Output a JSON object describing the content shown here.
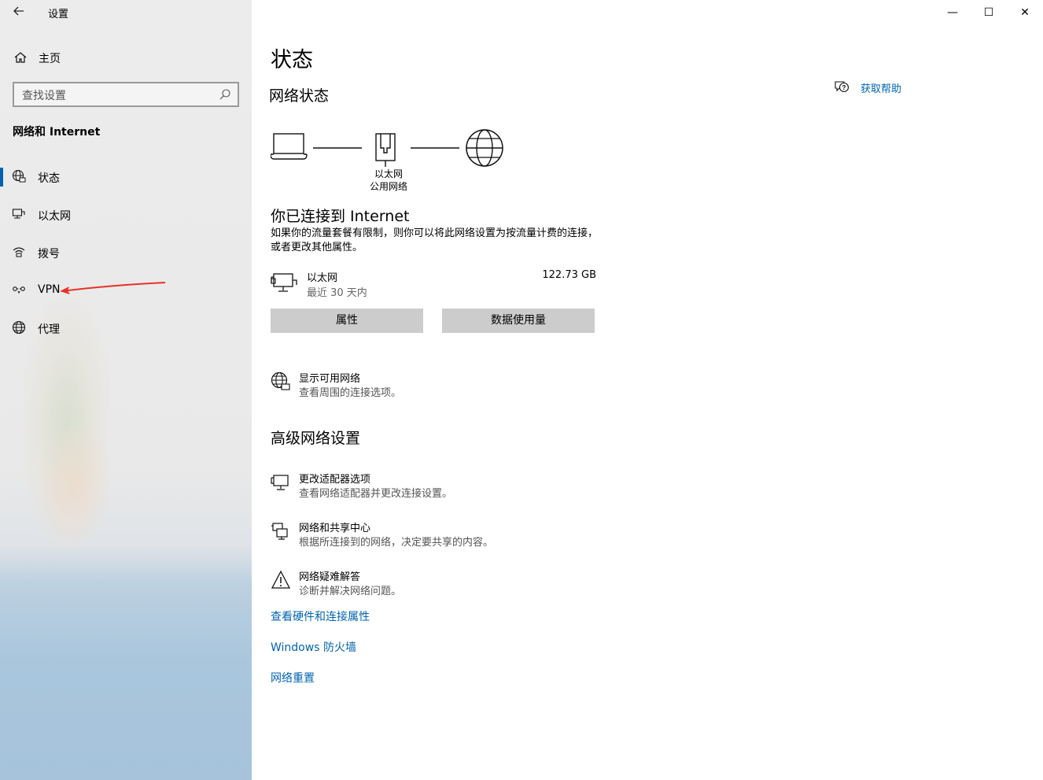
{
  "window": {
    "title": "设置",
    "controls": {
      "minimize": "—",
      "maximize": "☐",
      "close": "✕"
    }
  },
  "sidebar": {
    "home_label": "主页",
    "search_placeholder": "查找设置",
    "section_title": "网络和 Internet",
    "items": [
      {
        "label": "状态",
        "icon": "globe-monitor-icon",
        "active": true
      },
      {
        "label": "以太网",
        "icon": "ethernet-icon",
        "active": false
      },
      {
        "label": "拨号",
        "icon": "dialup-icon",
        "active": false
      },
      {
        "label": "VPN",
        "icon": "vpn-icon",
        "active": false
      },
      {
        "label": "代理",
        "icon": "globe-icon",
        "active": false
      }
    ],
    "annotation_arrow_color": "#e8312a"
  },
  "main": {
    "page_title": "状态",
    "network_status_title": "网络状态",
    "help_label": "获取帮助",
    "diagram": {
      "adapter_name": "以太网",
      "network_type": "公用网络"
    },
    "connected_title": "你已连接到 Internet",
    "connected_desc": "如果你的流量套餐有限制，则你可以将此网络设置为按流量计费的连接，或者更改其他属性。",
    "adapter": {
      "name": "以太网",
      "period": "最近 30 天内",
      "usage": "122.73 GB"
    },
    "buttons": {
      "properties": "属性",
      "data_usage": "数据使用量"
    },
    "show_networks": {
      "title": "显示可用网络",
      "desc": "查看周围的连接选项。"
    },
    "advanced_title": "高级网络设置",
    "advanced_items": [
      {
        "title": "更改适配器选项",
        "desc": "查看网络适配器并更改连接设置。"
      },
      {
        "title": "网络和共享中心",
        "desc": "根据所连接到的网络，决定要共享的内容。"
      },
      {
        "title": "网络疑难解答",
        "desc": "诊断并解决网络问题。"
      }
    ],
    "links": {
      "hardware": "查看硬件和连接属性",
      "firewall": "Windows 防火墙",
      "reset": "网络重置"
    },
    "accent_color": "#0063b1"
  }
}
